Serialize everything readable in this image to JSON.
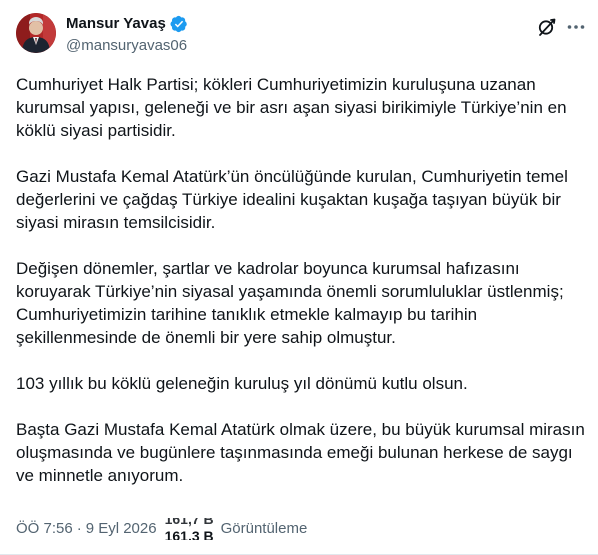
{
  "author": {
    "display_name": "Mansur Yavaş",
    "handle": "@mansuryavas06",
    "verified": true,
    "avatar": "profile-photo"
  },
  "actions": {
    "grok_icon": "grok-icon",
    "more_icon": "more-options-icon"
  },
  "tweet": {
    "paragraphs": [
      "Cumhuriyet Halk Partisi; kökleri Cumhuriyetimizin kuruluşuna uzanan kurumsal yapısı, geleneği ve bir asrı aşan siyasi birikimiyle Türkiye’nin en köklü siyasi partisidir.",
      "Gazi Mustafa Kemal Atatürk’ün öncülüğünde kurulan, Cumhuriyetin temel değerlerini ve çağdaş Türkiye idealini kuşaktan kuşağa taşıyan büyük bir siyasi mirasın temsilcisidir.",
      "Değişen dönemler, şartlar ve kadrolar boyunca kurumsal hafızasını koruyarak Türkiye’nin siyasal yaşamında önemli sorumluluklar üstlenmiş; Cumhuriyetimizin tarihine tanıklık etmekle kalmayıp bu tarihin şekillenmesinde de önemli bir yere sahip olmuştur.",
      "103 yıllık bu köklü geleneğin kuruluş yıl dönümü kutlu olsun.",
      "Başta Gazi Mustafa Kemal Atatürk olmak üzere, bu büyük kurumsal mirasın oluşmasında ve bugünlere taşınmasında emeği bulunan herkese de saygı ve minnetle anıyorum."
    ]
  },
  "meta": {
    "time": "ÖÖ 7:56",
    "separator": "·",
    "date": "9 Eyl 2026",
    "views_ghost": "161,7 B",
    "views_count": "161,3 B",
    "views_label": "Görüntüleme"
  },
  "colors": {
    "verified_blue": "#1d9bf0",
    "text_primary": "#0f1419",
    "text_secondary": "#536471"
  }
}
